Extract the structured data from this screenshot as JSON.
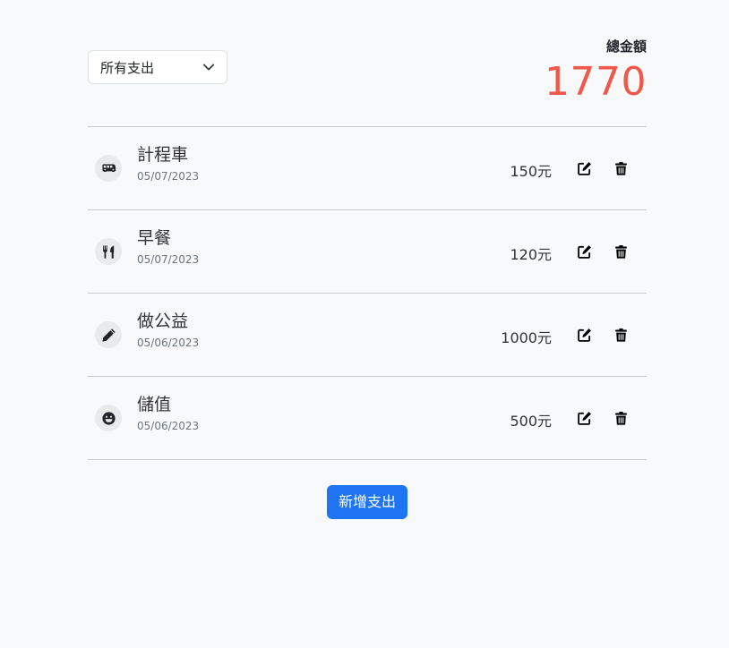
{
  "filter": {
    "selected": "所有支出"
  },
  "total": {
    "label": "總金額",
    "amount": "1770"
  },
  "expenses": [
    {
      "title": "計程車",
      "date": "05/07/2023",
      "amount": "150元",
      "icon": "bus-icon"
    },
    {
      "title": "早餐",
      "date": "05/07/2023",
      "amount": "120元",
      "icon": "utensils-icon"
    },
    {
      "title": "做公益",
      "date": "05/06/2023",
      "amount": "1000元",
      "icon": "pencil-icon"
    },
    {
      "title": "儲值",
      "date": "05/06/2023",
      "amount": "500元",
      "icon": "smile-icon"
    }
  ],
  "add_button": {
    "label": "新增支出"
  },
  "colors": {
    "total": "#f0584c",
    "primary": "#1f74f4"
  }
}
